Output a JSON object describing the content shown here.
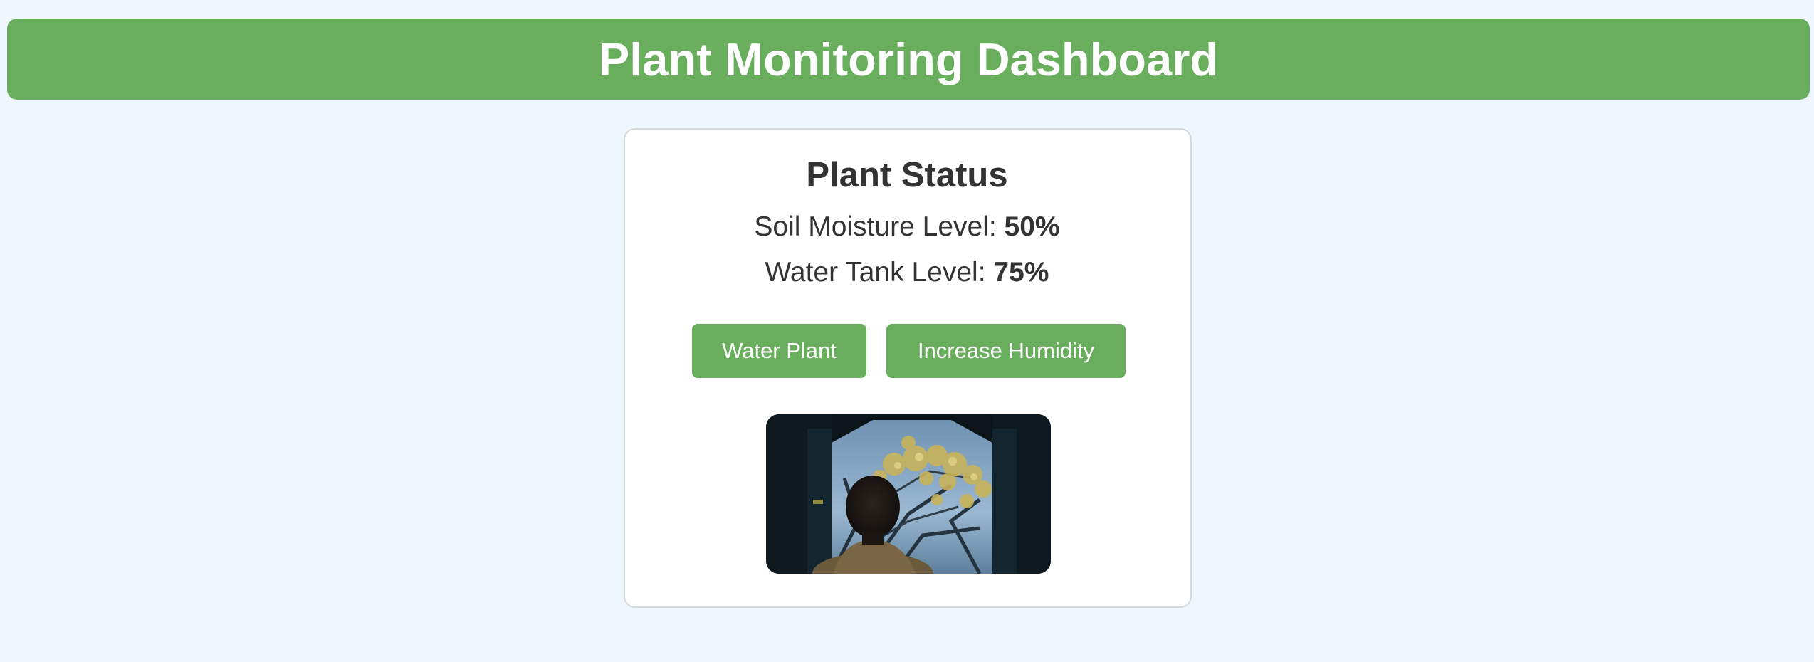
{
  "header": {
    "title": "Plant Monitoring Dashboard"
  },
  "status_card": {
    "title": "Plant Status",
    "soil_moisture_label": "Soil Moisture Level: ",
    "soil_moisture_value": "50%",
    "water_tank_label": "Water Tank Level: ",
    "water_tank_value": "75%",
    "buttons": {
      "water_label": "Water Plant",
      "humidity_label": "Increase Humidity"
    },
    "image": {
      "icon": "plant-scene-image"
    }
  },
  "colors": {
    "accent": "#69ae5d",
    "page_background": "#eff7fe",
    "card_background": "#ffffff",
    "text": "#333333"
  }
}
